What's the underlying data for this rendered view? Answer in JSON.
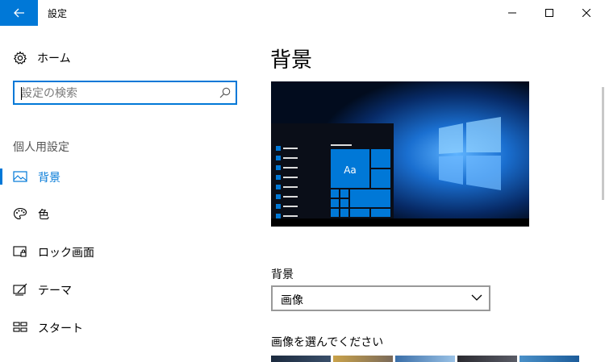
{
  "window": {
    "title": "設定"
  },
  "sidebar": {
    "home_label": "ホーム",
    "search_placeholder": "設定の検索",
    "section_title": "個人用設定",
    "items": [
      {
        "label": "背景",
        "active": true,
        "icon": "picture-icon"
      },
      {
        "label": "色",
        "active": false,
        "icon": "palette-icon"
      },
      {
        "label": "ロック画面",
        "active": false,
        "icon": "lock-screen-icon"
      },
      {
        "label": "テーマ",
        "active": false,
        "icon": "theme-icon"
      },
      {
        "label": "スタート",
        "active": false,
        "icon": "start-icon"
      }
    ]
  },
  "main": {
    "page_title": "背景",
    "preview_tile_text": "Aa",
    "background_label": "背景",
    "background_value": "画像",
    "choose_picture_label": "画像を選んでください"
  },
  "colors": {
    "accent": "#0078d7"
  }
}
